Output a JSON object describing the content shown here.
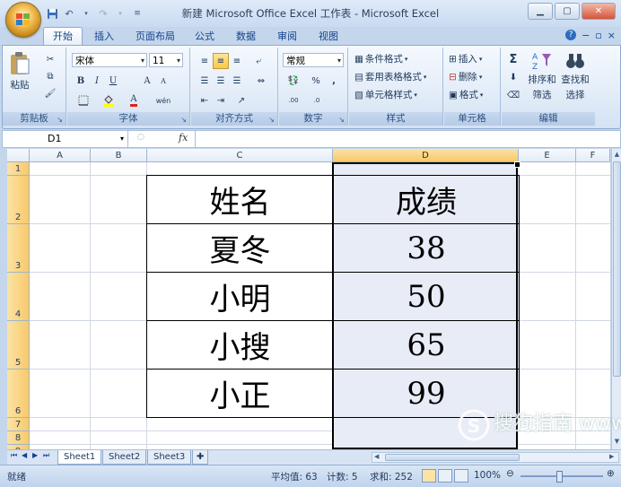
{
  "window": {
    "title": "新建 Microsoft Office Excel 工作表 - Microsoft Excel",
    "qat": [
      "save-icon",
      "undo-icon",
      "redo-icon",
      "customize-icon"
    ]
  },
  "tabs": [
    {
      "label": "开始",
      "active": true
    },
    {
      "label": "插入"
    },
    {
      "label": "页面布局"
    },
    {
      "label": "公式"
    },
    {
      "label": "数据"
    },
    {
      "label": "审阅"
    },
    {
      "label": "视图"
    }
  ],
  "ribbon": {
    "clipboard": {
      "label": "剪贴板",
      "paste": "粘贴"
    },
    "font": {
      "label": "字体",
      "name": "宋体",
      "size": "11",
      "bold": "B",
      "italic": "I",
      "underline": "U",
      "grow": "A",
      "shrink": "A",
      "color": "A",
      "phonetic": "wén"
    },
    "alignment": {
      "label": "对齐方式"
    },
    "number": {
      "label": "数字",
      "format": "常规",
      "percent": "%",
      "comma": ",",
      "inc": ".00",
      "dec": ".0"
    },
    "styles": {
      "label": "样式",
      "conditional": "条件格式",
      "table": "套用表格格式",
      "cell": "单元格样式"
    },
    "cells": {
      "label": "单元格",
      "insert": "插入",
      "delete": "删除",
      "format": "格式"
    },
    "editing": {
      "label": "编辑",
      "sigma": "Σ",
      "sort": "排序和",
      "filter": "筛选",
      "find": "查找和",
      "select": "选择"
    }
  },
  "formula_bar": {
    "name_box": "D1",
    "fx": "fx",
    "value": ""
  },
  "grid": {
    "columns": [
      "A",
      "B",
      "C",
      "D",
      "E",
      "F"
    ],
    "rows": [
      "1",
      "2",
      "3",
      "4",
      "5",
      "6",
      "7",
      "8",
      "9"
    ],
    "selected_column": "D",
    "table": [
      [
        "姓名",
        "成绩"
      ],
      [
        "夏冬",
        "38"
      ],
      [
        "小明",
        "50"
      ],
      [
        "小搜",
        "65"
      ],
      [
        "小正",
        "99"
      ]
    ]
  },
  "sheets": [
    {
      "label": "Sheet1",
      "active": true
    },
    {
      "label": "Sheet2"
    },
    {
      "label": "Sheet3"
    }
  ],
  "status": {
    "ready": "就绪",
    "average": "平均值: 63",
    "count": "计数: 5",
    "sum": "求和: 252",
    "zoom": "100%"
  },
  "watermark": "搜狗指南 www.zhinan.sogo.com",
  "colors": {
    "selection": "#000000",
    "header_highlight": "#f8c96a",
    "ribbon_text": "#15428b"
  }
}
